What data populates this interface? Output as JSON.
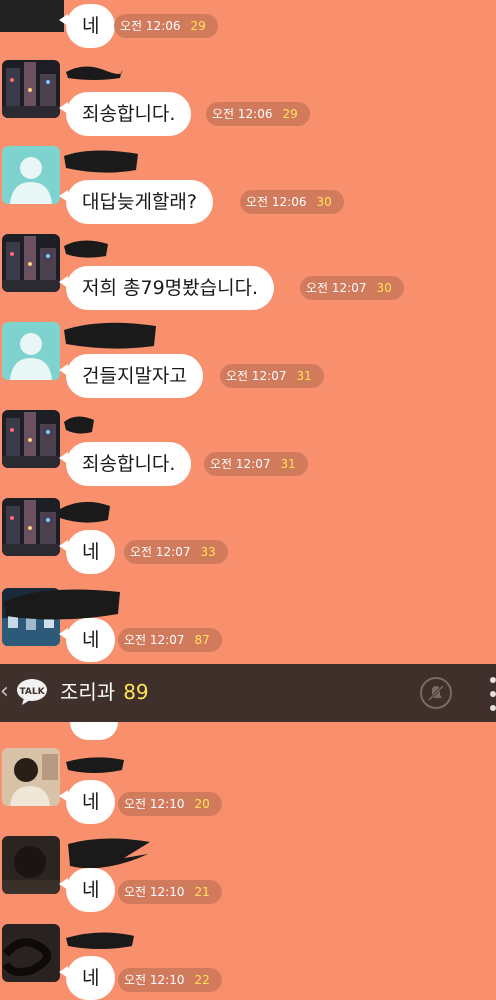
{
  "chat_header": {
    "back_icon": "chevron-left-icon",
    "talk_icon_label": "TALK",
    "room_name": "조리과",
    "member_count": "89",
    "mute_icon": "bell-off-icon",
    "menu_icon": "more-vertical-icon"
  },
  "messages": [
    {
      "text": "네",
      "time": "오전 12:06",
      "unread": "29",
      "avatar": "none"
    },
    {
      "text": "죄송합니다.",
      "time": "오전 12:06",
      "unread": "29",
      "avatar": "city-photo"
    },
    {
      "text": "대답늦게할래?",
      "time": "오전 12:06",
      "unread": "30",
      "avatar": "default-profile"
    },
    {
      "text": "저희 총79명봤습니다.",
      "time": "오전 12:07",
      "unread": "30",
      "avatar": "city-photo"
    },
    {
      "text": "건들지말자고",
      "time": "오전 12:07",
      "unread": "31",
      "avatar": "default-profile"
    },
    {
      "text": "죄송합니다.",
      "time": "오전 12:07",
      "unread": "31",
      "avatar": "city-photo"
    },
    {
      "text": "네",
      "time": "오전 12:07",
      "unread": "33",
      "avatar": "city-photo"
    },
    {
      "text": "네",
      "time": "오전 12:07",
      "unread": "87",
      "avatar": "blue-photo"
    },
    {
      "text": "네",
      "time": "오전 12:10",
      "unread": "20",
      "avatar": "person-photo"
    },
    {
      "text": "네",
      "time": "오전 12:10",
      "unread": "21",
      "avatar": "dark-photo"
    },
    {
      "text": "네",
      "time": "오전 12:10",
      "unread": "22",
      "avatar": "scribble-photo"
    }
  ],
  "colors": {
    "background": "#f8906e",
    "bubble": "#ffffff",
    "meta_pill": "#d27a5c",
    "unread": "#ffe357",
    "header_bar": "#3f302c"
  }
}
